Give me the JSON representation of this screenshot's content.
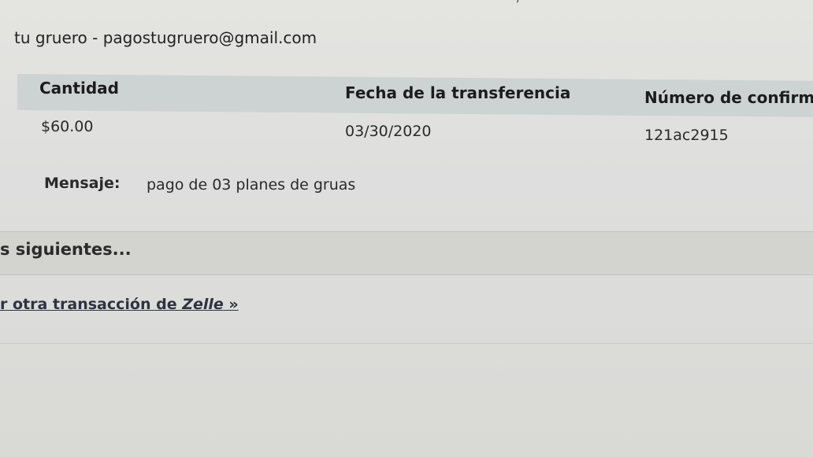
{
  "recipient": {
    "text": "tu gruero - pagostugruero@gmail.com"
  },
  "table": {
    "headers": [
      "Cantidad",
      "Fecha de la transferencia",
      "Número de confirma"
    ],
    "values": [
      "$60.00",
      "03/30/2020",
      "121ac2915"
    ]
  },
  "message": {
    "label": "Mensaje:",
    "text": "pago de 03 planes de gruas"
  },
  "section": {
    "title": "s siguientes..."
  },
  "link": {
    "prefix": "r otra transacción de ",
    "brand": "Zelle",
    "suffix": " »"
  }
}
